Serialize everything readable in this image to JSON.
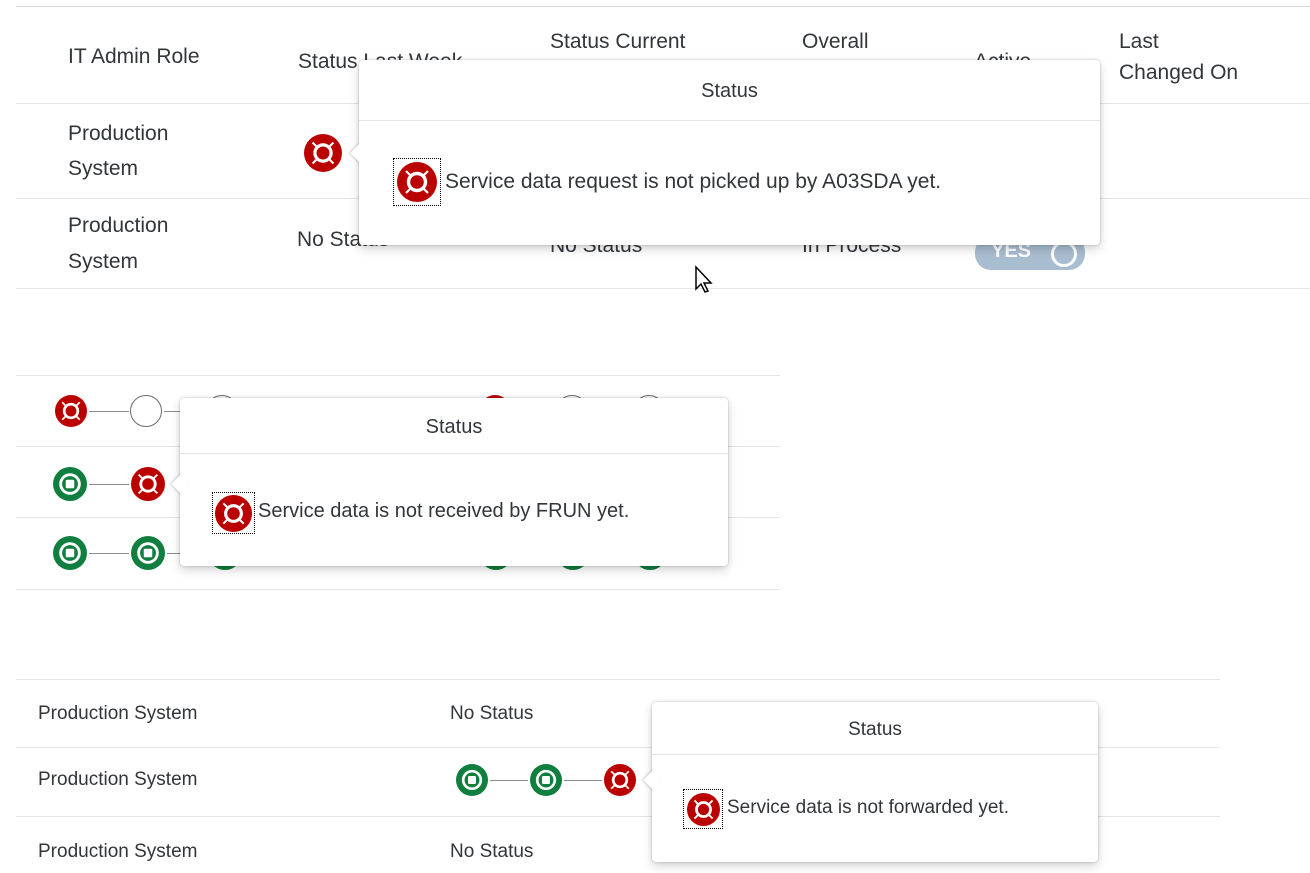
{
  "table1": {
    "headers": {
      "role": "IT Admin Role",
      "last_week": "Status Last Week",
      "current_l1": "Status Current",
      "overall_l1": "Overall",
      "active": "Active",
      "changed_l1": "Last",
      "changed_l2": "Changed On"
    },
    "rows": [
      {
        "role_l1": "Production",
        "role_l2": "System",
        "status_icon": "error-icon"
      },
      {
        "role_l1": "Production",
        "role_l2": "System",
        "last_week": "No Status",
        "current": "No Status",
        "overall": "In Process",
        "active": "YES"
      }
    ],
    "popover": {
      "title": "Status",
      "message": "Service data request is not picked up by A03SDA yet."
    }
  },
  "table2": {
    "rows": [
      {
        "icons": [
          "error-icon",
          "empty-ring-icon",
          "empty-ring-icon"
        ],
        "right_icons": [
          "error-icon",
          "empty-ring-icon",
          "empty-ring-icon"
        ]
      },
      {
        "icons": [
          "success-icon",
          "error-icon"
        ]
      },
      {
        "icons": [
          "success-icon",
          "success-icon",
          "success-icon"
        ],
        "right_icons": [
          "success-icon",
          "success-icon",
          "success-icon"
        ]
      }
    ],
    "popover": {
      "title": "Status",
      "message": "Service data is not received by FRUN yet."
    }
  },
  "table3": {
    "rows": [
      {
        "role": "Production System",
        "status": "No Status"
      },
      {
        "role": "Production System",
        "icons": [
          "success-icon",
          "success-icon",
          "error-icon"
        ]
      },
      {
        "role": "Production System",
        "status": "No Status"
      }
    ],
    "popover": {
      "title": "Status",
      "message": "Service data is not forwarded yet."
    }
  },
  "colors": {
    "error": "#bb0000",
    "success": "#107e3e",
    "toggle": "#a9bdd0",
    "divider": "#e5e5e5"
  }
}
